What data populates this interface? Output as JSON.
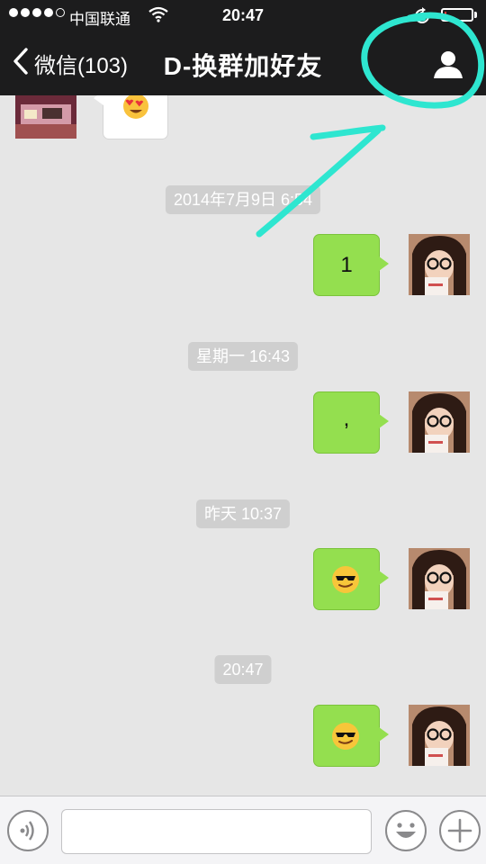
{
  "status_bar": {
    "carrier": "中国联通",
    "time": "20:47",
    "battery_level": 0.08
  },
  "nav": {
    "back_label": "微信(103)",
    "title": "D-换群加好友"
  },
  "chat": {
    "messages": [
      {
        "type": "emoji",
        "side": "left",
        "content": "heart-eyes-emoji"
      },
      {
        "type": "timestamp",
        "text": "2014年7月9日 6:54"
      },
      {
        "type": "text",
        "side": "right",
        "text": "1"
      },
      {
        "type": "timestamp",
        "text": "星期一 16:43"
      },
      {
        "type": "text",
        "side": "right",
        "text": ","
      },
      {
        "type": "timestamp",
        "text": "昨天 10:37"
      },
      {
        "type": "emoji",
        "side": "right",
        "content": "cool-sunglasses-emoji"
      },
      {
        "type": "timestamp",
        "text": "20:47"
      },
      {
        "type": "emoji",
        "side": "right",
        "content": "cool-sunglasses-emoji"
      }
    ]
  },
  "input_bar": {
    "text_value": ""
  },
  "colors": {
    "bubble_green": "#94df4f",
    "annotation_cyan": "#2ee6d0",
    "header_bg": "#1c1c1d"
  }
}
